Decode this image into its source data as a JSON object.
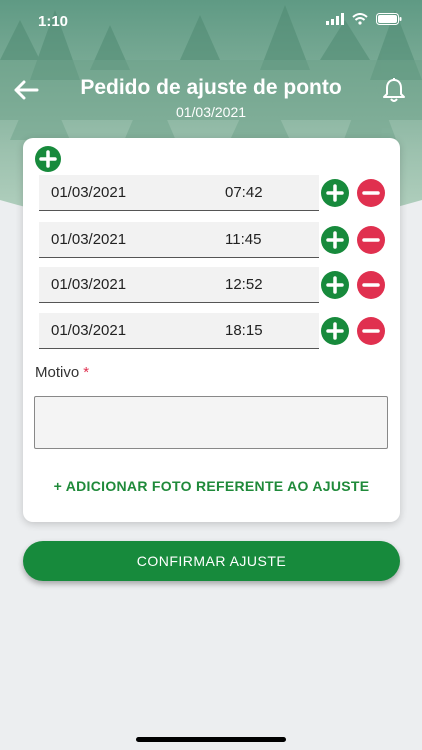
{
  "status_bar": {
    "time": "1:10",
    "icons": [
      "signal-icon",
      "wifi-icon",
      "battery-icon"
    ]
  },
  "header": {
    "title": "Pedido de ajuste de ponto",
    "date": "01/03/2021",
    "back_icon": "arrow-left-icon",
    "notification_icon": "bell-icon"
  },
  "entries": [
    {
      "date": "01/03/2021",
      "time": "07:42"
    },
    {
      "date": "01/03/2021",
      "time": "11:45"
    },
    {
      "date": "01/03/2021",
      "time": "12:52"
    },
    {
      "date": "01/03/2021",
      "time": "18:15"
    }
  ],
  "form": {
    "motivo_label": "Motivo",
    "required_mark": "*",
    "motivo_value": "",
    "add_photo_label": "+ ADICIONAR FOTO REFERENTE AO AJUSTE"
  },
  "actions": {
    "confirm_label": "CONFIRMAR AJUSTE"
  },
  "colors": {
    "primary_green": "#178a3c",
    "remove_red": "#e0304f",
    "header_green": "#7fae99"
  }
}
